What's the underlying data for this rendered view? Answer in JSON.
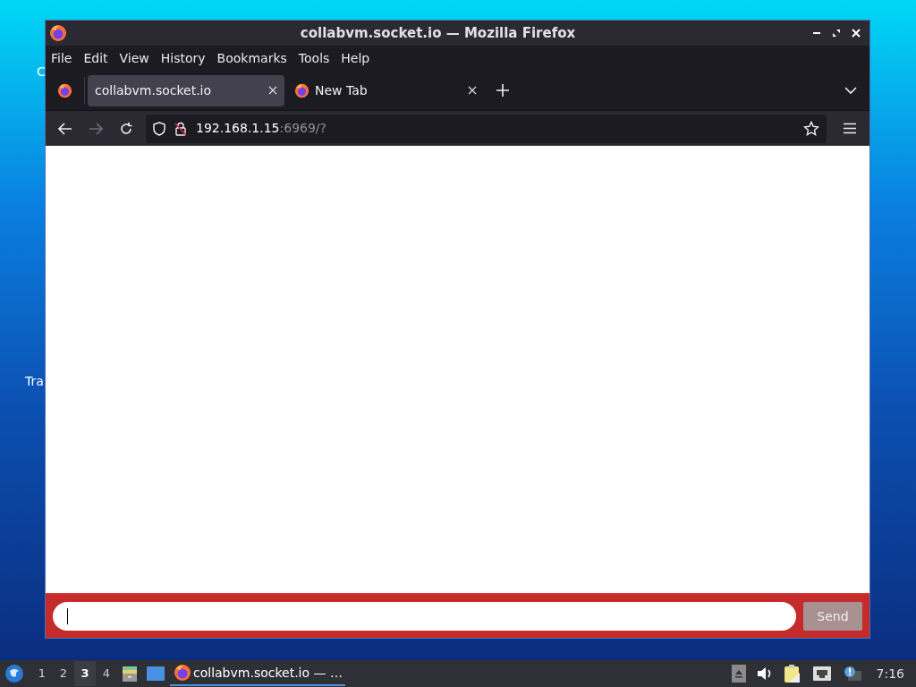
{
  "desktop": {
    "icon_labels": [
      "C",
      "Tra"
    ]
  },
  "window": {
    "title": "collabvm.socket.io — Mozilla Firefox"
  },
  "menu": [
    "File",
    "Edit",
    "View",
    "History",
    "Bookmarks",
    "Tools",
    "Help"
  ],
  "tabs": [
    {
      "label": "collabvm.socket.io",
      "selected": true
    },
    {
      "label": "New Tab",
      "selected": false
    }
  ],
  "nav": {
    "back_disabled": false,
    "forward_disabled": true,
    "url_host": "192.168.1.15",
    "url_rest": ":6969/?"
  },
  "chat": {
    "focused": true,
    "send_label": "Send",
    "send_disabled": true
  },
  "taskbar": {
    "workspaces": [
      {
        "label": "1",
        "selected": false
      },
      {
        "label": "2",
        "selected": false
      },
      {
        "label": "3",
        "selected": true
      },
      {
        "label": "4",
        "selected": false
      }
    ],
    "tasks": [
      {
        "label": "collabvm.socket.io — …",
        "selected": true
      }
    ],
    "clock": "7:16"
  }
}
